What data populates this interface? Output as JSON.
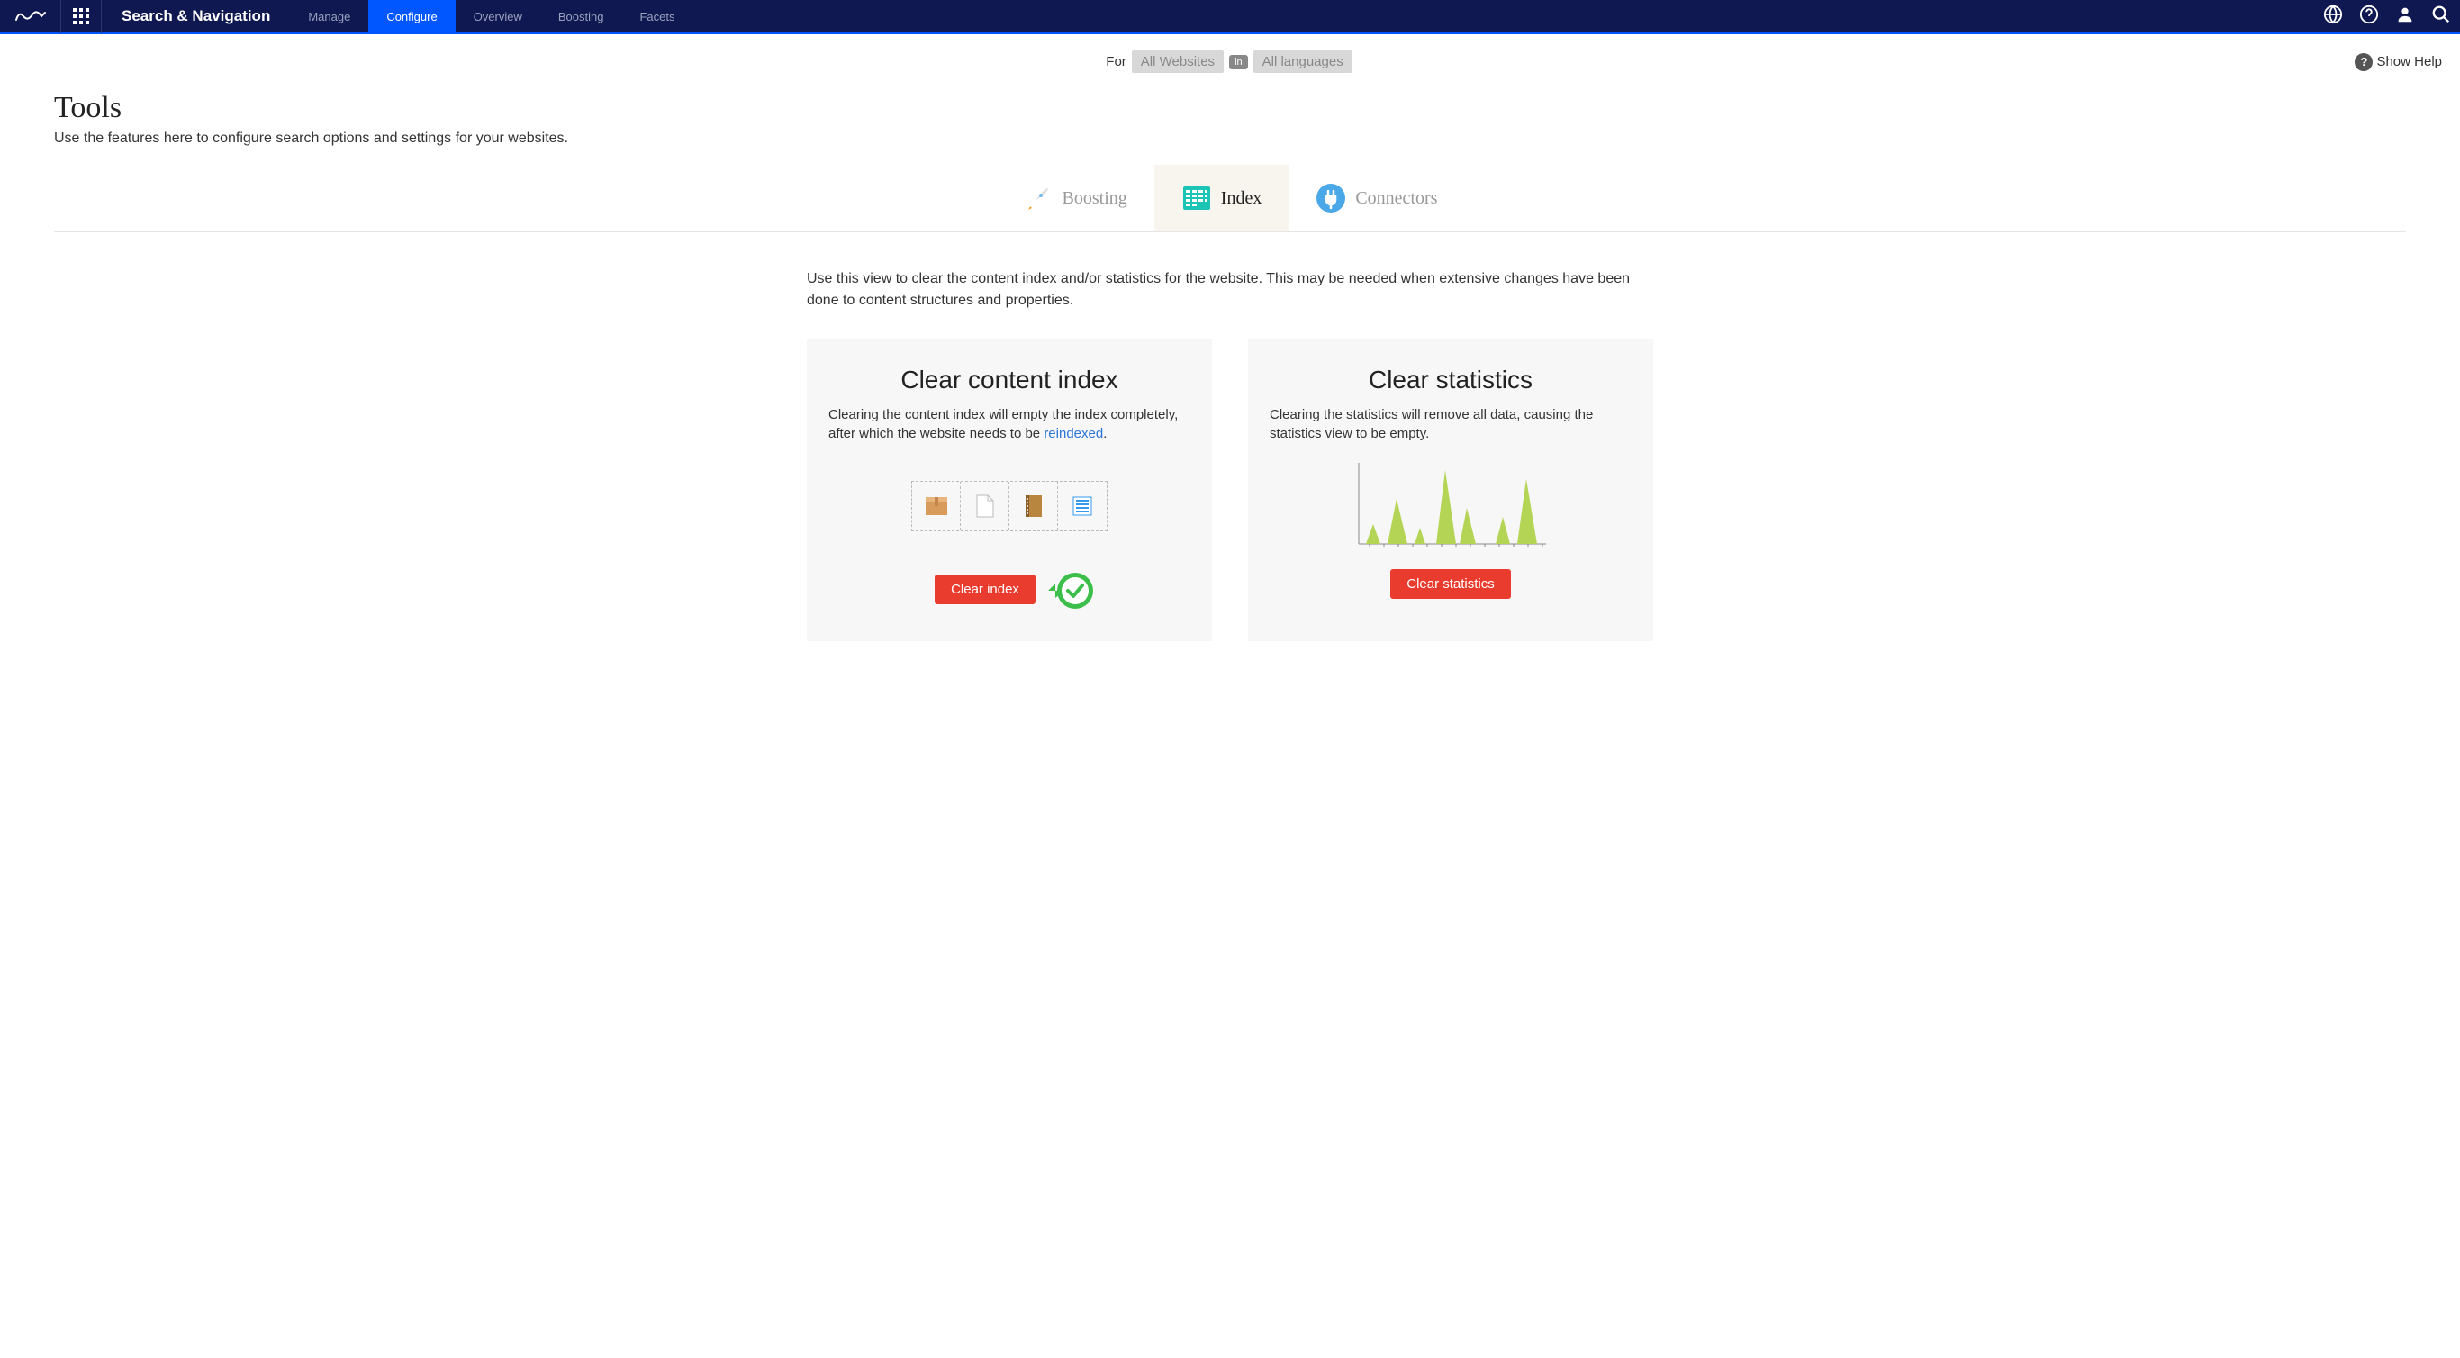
{
  "topbar": {
    "title": "Search & Navigation",
    "nav": [
      {
        "label": "Manage"
      },
      {
        "label": "Configure"
      },
      {
        "label": "Overview"
      },
      {
        "label": "Boosting"
      },
      {
        "label": "Facets"
      }
    ]
  },
  "filter": {
    "for_label": "For",
    "websites": "All Websites",
    "in_label": "in",
    "languages": "All languages",
    "show_help": "Show Help"
  },
  "page": {
    "title": "Tools",
    "subtitle": "Use the features here to configure search options and settings for your websites."
  },
  "subtabs": [
    {
      "label": "Boosting"
    },
    {
      "label": "Index"
    },
    {
      "label": "Connectors"
    }
  ],
  "main": {
    "description": "Use this view to clear the content index and/or statistics for the website. This may be needed when extensive changes have been done to content structures and properties."
  },
  "cards": {
    "clear_index": {
      "title": "Clear content index",
      "desc_prefix": "Clearing the content index will empty the index completely, after which the website needs to be ",
      "desc_link": "reindexed",
      "desc_suffix": ".",
      "button": "Clear index"
    },
    "clear_stats": {
      "title": "Clear statistics",
      "desc": "Clearing the statistics will remove all data, causing the statistics view to be empty.",
      "button": "Clear statistics"
    }
  }
}
